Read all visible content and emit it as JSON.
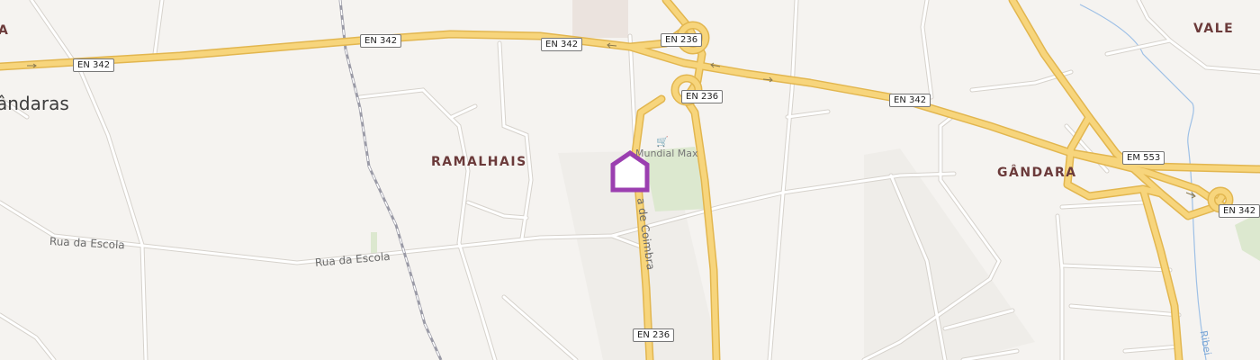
{
  "map": {
    "places": {
      "vale": "VALE",
      "ramalhais": "RAMALHAIS",
      "gandara": "GÂNDARA",
      "edge_left": "A",
      "town_left": "ândaras"
    },
    "streets": {
      "rua_escola_1": "Rua da Escola",
      "rua_escola_2": "Rua da Escola",
      "estrada_coimbra": "a de Coimbra"
    },
    "road_shields": {
      "en342_a": "EN 342",
      "en342_b": "EN 342",
      "en342_c": "EN 342",
      "en342_d": "EN 342",
      "en342_e": "EN 342",
      "en236_a": "EN 236",
      "en236_b": "EN 236",
      "en236_c": "EN 236",
      "em553": "EM 553"
    },
    "poi": {
      "name": "Mundial Max",
      "icon": "shopping-cart-icon"
    },
    "water": {
      "stream": "Ribei"
    },
    "marker": {
      "icon": "house-marker-icon",
      "color": "#9b3fb0"
    },
    "colors": {
      "background": "#f5f3f0",
      "road_major": "#f7d57c",
      "road_major_casing": "#e2b64f",
      "road_minor": "#ffffff",
      "road_minor_casing": "#d6d2cc",
      "railway": "#9a9aa6",
      "park": "#dce8cf",
      "water": "#7aa6d6"
    }
  }
}
